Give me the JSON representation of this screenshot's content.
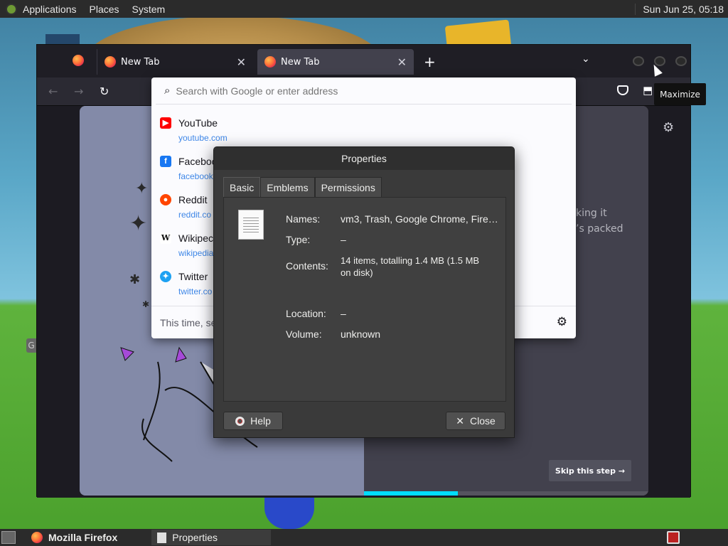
{
  "top_panel": {
    "menus": [
      "Applications",
      "Places",
      "System"
    ],
    "clock": "Sun Jun 25, 05:18"
  },
  "firefox": {
    "tabs": [
      {
        "label": "New Tab"
      },
      {
        "label": "New Tab"
      }
    ],
    "new_tab": "+",
    "list_all_tabs": "⌄",
    "tooltip": "Maximize",
    "urlbar": {
      "placeholder": "Search with Google or enter address"
    },
    "suggestions": [
      {
        "title": "YouTube",
        "url": "youtube.com",
        "icon": "youtube-icon",
        "color": "#ff0000"
      },
      {
        "title": "Faceboo",
        "url": "facebook",
        "icon": "facebook-icon",
        "color": "#1877f2"
      },
      {
        "title": "Reddit",
        "url": "reddit.co",
        "icon": "reddit-icon",
        "color": "#ff4500"
      },
      {
        "title": "Wikipec",
        "url": "wikipedia",
        "icon": "wikipedia-icon",
        "color": "#ffffff"
      },
      {
        "title": "Twitter",
        "url": "twitter.co",
        "icon": "twitter-icon",
        "color": "#1da1f2"
      }
    ],
    "dropdown_footer": "This time, se",
    "onboarding": {
      "text_line1": "king it",
      "text_line2": "’s packed",
      "skip": "Skip this step",
      "progress": 0.33
    }
  },
  "properties_dialog": {
    "title": "Properties",
    "tabs": [
      "Basic",
      "Emblems",
      "Permissions"
    ],
    "active_tab": "Basic",
    "fields": {
      "names_label": "Names:",
      "names_value": "vm3, Trash, Google Chrome, Fire…",
      "type_label": "Type:",
      "type_value": "–",
      "contents_label": "Contents:",
      "contents_value": "14 items, totalling 1.4 MB (1.5 MB on disk)",
      "location_label": "Location:",
      "location_value": "–",
      "volume_label": "Volume:",
      "volume_value": "unknown"
    },
    "help_button": "Help",
    "close_button": "Close"
  },
  "taskbar": {
    "tasks": [
      {
        "label": "Mozilla Firefox"
      },
      {
        "label": "Properties"
      }
    ]
  },
  "left_edge_tag": "G"
}
